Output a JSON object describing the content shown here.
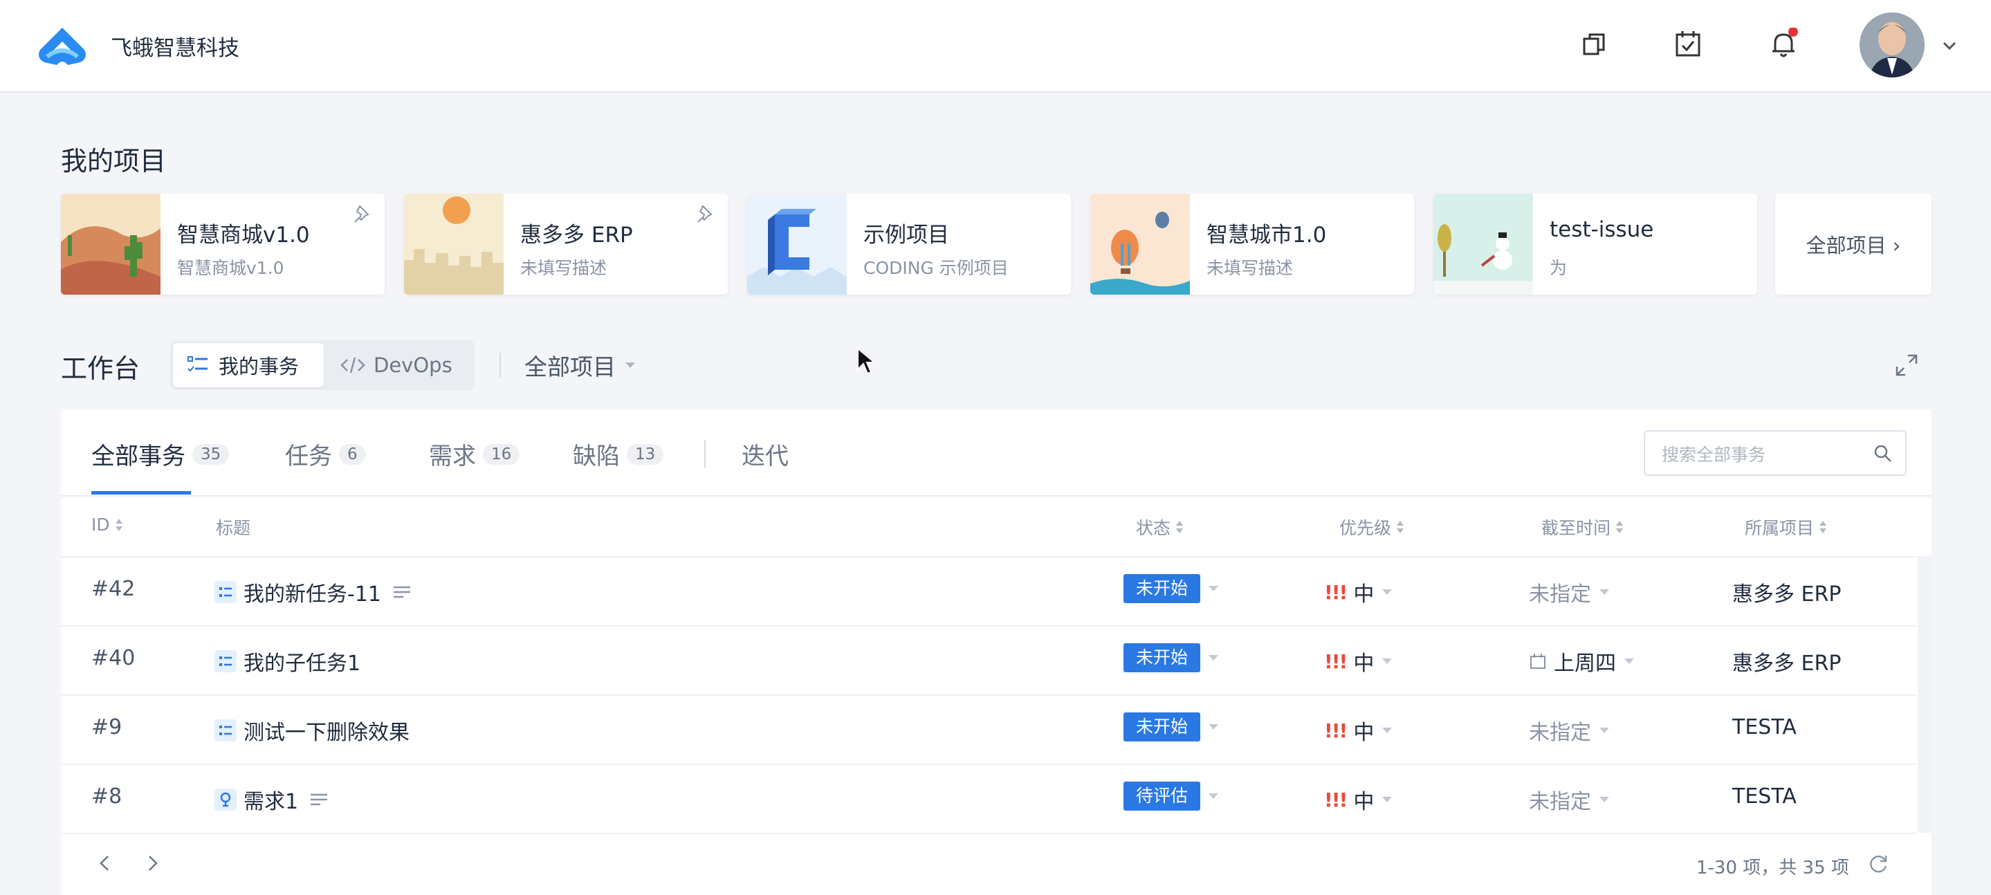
{
  "header": {
    "brand": "飞蛾智慧科技",
    "icons": [
      "copy-icon",
      "calendar-check-icon",
      "bell-icon"
    ],
    "notification_dot_color": "#e5323b"
  },
  "projects_section": {
    "title": "我的项目",
    "cards": [
      {
        "name": "智慧商城v1.0",
        "desc": "智慧商城v1.0",
        "pinned": true
      },
      {
        "name": "惠多多 ERP",
        "desc": "未填写描述",
        "pinned": true
      },
      {
        "name": "示例项目",
        "desc": "CODING 示例项目",
        "pinned": false
      },
      {
        "name": "智慧城市1.0",
        "desc": "未填写描述",
        "pinned": false
      },
      {
        "name": "test-issue",
        "desc": "为",
        "pinned": false
      }
    ],
    "all_projects_label": "全部项目 ›"
  },
  "workbench": {
    "title": "工作台",
    "segment_my": "我的事务",
    "segment_devops": "DevOps",
    "project_filter": "全部项目"
  },
  "tabs": [
    {
      "label": "全部事务",
      "count": "35"
    },
    {
      "label": "任务",
      "count": "6"
    },
    {
      "label": "需求",
      "count": "16"
    },
    {
      "label": "缺陷",
      "count": "13"
    },
    {
      "label": "迭代",
      "count": ""
    }
  ],
  "search": {
    "placeholder": "搜索全部事务"
  },
  "table": {
    "columns": {
      "id": "ID",
      "title": "标题",
      "status": "状态",
      "priority": "优先级",
      "due": "截至时间",
      "project": "所属项目"
    },
    "rows": [
      {
        "id": "#42",
        "title": "我的新任务-11",
        "type": "task",
        "status": "未开始",
        "priority_mark": "!!!",
        "priority": "中",
        "due": "未指定",
        "project": "惠多多 ERP"
      },
      {
        "id": "#40",
        "title": "我的子任务1",
        "type": "task",
        "status": "未开始",
        "priority_mark": "!!!",
        "priority": "中",
        "due": "上周四",
        "project": "惠多多 ERP"
      },
      {
        "id": "#9",
        "title": "测试一下删除效果",
        "type": "task",
        "status": "未开始",
        "priority_mark": "!!!",
        "priority": "中",
        "due": "未指定",
        "project": "TESTA"
      },
      {
        "id": "#8",
        "title": "需求1",
        "type": "requirement",
        "status": "待评估",
        "priority_mark": "!!!",
        "priority": "中",
        "due": "未指定",
        "project": "TESTA"
      }
    ]
  },
  "footer": {
    "pager_info": "1-30 项，共 35 项"
  },
  "colors": {
    "accent": "#2a78e4",
    "priority": "#e84b3c"
  }
}
